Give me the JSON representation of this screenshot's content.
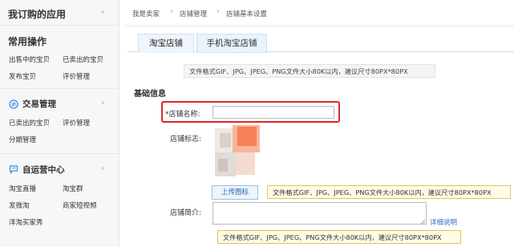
{
  "sidebar": {
    "my_apps_title": "我订购的应用",
    "common_ops": {
      "title": "常用操作",
      "links": [
        "出售中的宝贝",
        "已卖出的宝贝",
        "发布宝贝",
        "评价管理"
      ]
    },
    "trade": {
      "title": "交易管理",
      "links": [
        "已卖出的宝贝",
        "评价管理",
        "分期管理"
      ]
    },
    "self_ops": {
      "title": "自运营中心",
      "links": [
        "淘宝直播",
        "淘宝群",
        "发微淘",
        "商家短视频",
        "洋淘买家秀"
      ]
    },
    "arrow": "›"
  },
  "breadcrumb": [
    "我是卖家",
    "店铺管理",
    "店铺基本设置"
  ],
  "breadcrumb_sep": "›",
  "tabs": [
    "淘宝店铺",
    "手机淘宝店铺"
  ],
  "notes": {
    "top": "文件格式GIF、JPG、JPEG、PNG文件大小80K以内，建议尺寸80PX*80PX",
    "logo": "文件格式GIF、JPG、JPEG、PNG文件大小80K以内，建议尺寸80PX*80PX",
    "bottom": "文件格式GIF、JPG、JPEG、PNG文件大小80K以内，建议尺寸80PX*80PX"
  },
  "form": {
    "section_title": "基础信息",
    "shop_name_label": "*店铺名称:",
    "shop_name_value": "",
    "logo_label": "店铺标志:",
    "upload_button": "上传图标",
    "intro_label": "店铺简介:",
    "intro_value": "",
    "details_link": "详细说明"
  },
  "colors": {
    "highlight_box": "#e0282a",
    "tab_border": "#cfe0ef",
    "note_border_yellow": "#e8c15a",
    "link_blue": "#2e6fc4"
  }
}
